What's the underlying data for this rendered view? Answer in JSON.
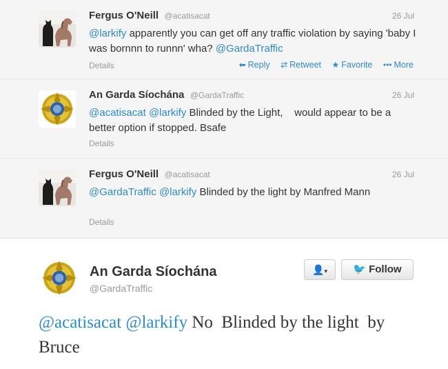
{
  "thread": [
    {
      "name": "Fergus O'Neill",
      "handle": "@acatisacat",
      "date": "26 Jul",
      "mentions": [
        "@larkify"
      ],
      "text": "apparently you can get off any traffic violation by saying 'baby I was bornnn to runnn' wha?",
      "trailing_mention": "@GardaTraffic",
      "details": "Details",
      "actions": {
        "reply": "Reply",
        "retweet": "Retweet",
        "favorite": "Favorite",
        "more": "More"
      }
    },
    {
      "name": "An Garda Síochána",
      "handle": "@GardaTraffic",
      "date": "26 Jul",
      "mentions": [
        "@acatisacat",
        "@larkify"
      ],
      "text": "Blinded by the Light,    would appear to be a better option if stopped. Bsafe",
      "details": "Details"
    },
    {
      "name": "Fergus O'Neill",
      "handle": "@acatisacat",
      "date": "26 Jul",
      "mentions": [
        "@GardaTraffic",
        "@larkify"
      ],
      "text": "Blinded by the light by Manfred Mann",
      "details": "Details"
    }
  ],
  "main": {
    "name": "An Garda Síochána",
    "handle": "@GardaTraffic",
    "follow_label": "Follow",
    "mentions": [
      "@acatisacat",
      "@larkify"
    ],
    "text": "No  Blinded by the light  by Bruce"
  },
  "colors": {
    "link": "#2e8bc9",
    "bird": "#2e9ede",
    "thread_bg": "#f5f5f5"
  },
  "icons": {
    "reply": "reply-arrow-icon",
    "retweet": "retweet-icon",
    "favorite": "star-icon",
    "more": "ellipsis-icon",
    "user_menu": "user-icon",
    "follow": "twitter-bird-icon"
  }
}
